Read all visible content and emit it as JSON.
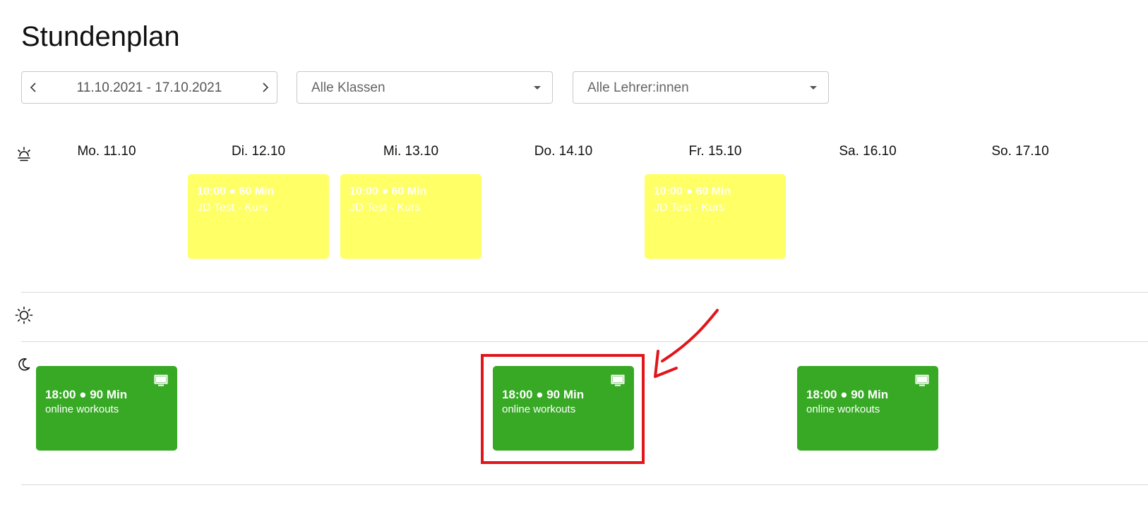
{
  "page": {
    "title": "Stundenplan"
  },
  "filters": {
    "date_range": "11.10.2021 - 17.10.2021",
    "classes_select": "Alle Klassen",
    "teachers_select": "Alle Lehrer:innen"
  },
  "days": [
    {
      "label": "Mo. 11.10"
    },
    {
      "label": "Di. 12.10"
    },
    {
      "label": "Mi. 13.10"
    },
    {
      "label": "Do. 14.10"
    },
    {
      "label": "Fr. 15.10"
    },
    {
      "label": "Sa. 16.10"
    },
    {
      "label": "So. 17.10"
    }
  ],
  "sections": {
    "morning_icon": "sunrise-icon",
    "midday_icon": "sun-icon",
    "evening_icon": "moon-icon"
  },
  "morning_events": [
    {
      "day": "Di. 12.10",
      "time": "10:00 ● 60 Min",
      "name": "JD Test - Kurs"
    },
    {
      "day": "Mi. 13.10",
      "time": "10:00 ● 60 Min",
      "name": "JD Test - Kurs"
    },
    {
      "day": "Fr. 15.10",
      "time": "10:00 ● 60 Min",
      "name": "JD Test - Kurs"
    }
  ],
  "evening_events": [
    {
      "day": "Mo. 11.10",
      "time": "18:00 ● 90 Min",
      "name": "online workouts",
      "icon": "monitor-icon"
    },
    {
      "day": "Do. 14.10",
      "time": "18:00 ● 90 Min",
      "name": "online workouts",
      "icon": "monitor-icon",
      "highlighted": true
    },
    {
      "day": "Sa. 16.10",
      "time": "18:00 ● 90 Min",
      "name": "online workouts",
      "icon": "monitor-icon"
    }
  ],
  "colors": {
    "morning_event": "#ffff66",
    "evening_event": "#37a925",
    "annotation": "#e0161b",
    "divider": "#d9d9d9"
  }
}
